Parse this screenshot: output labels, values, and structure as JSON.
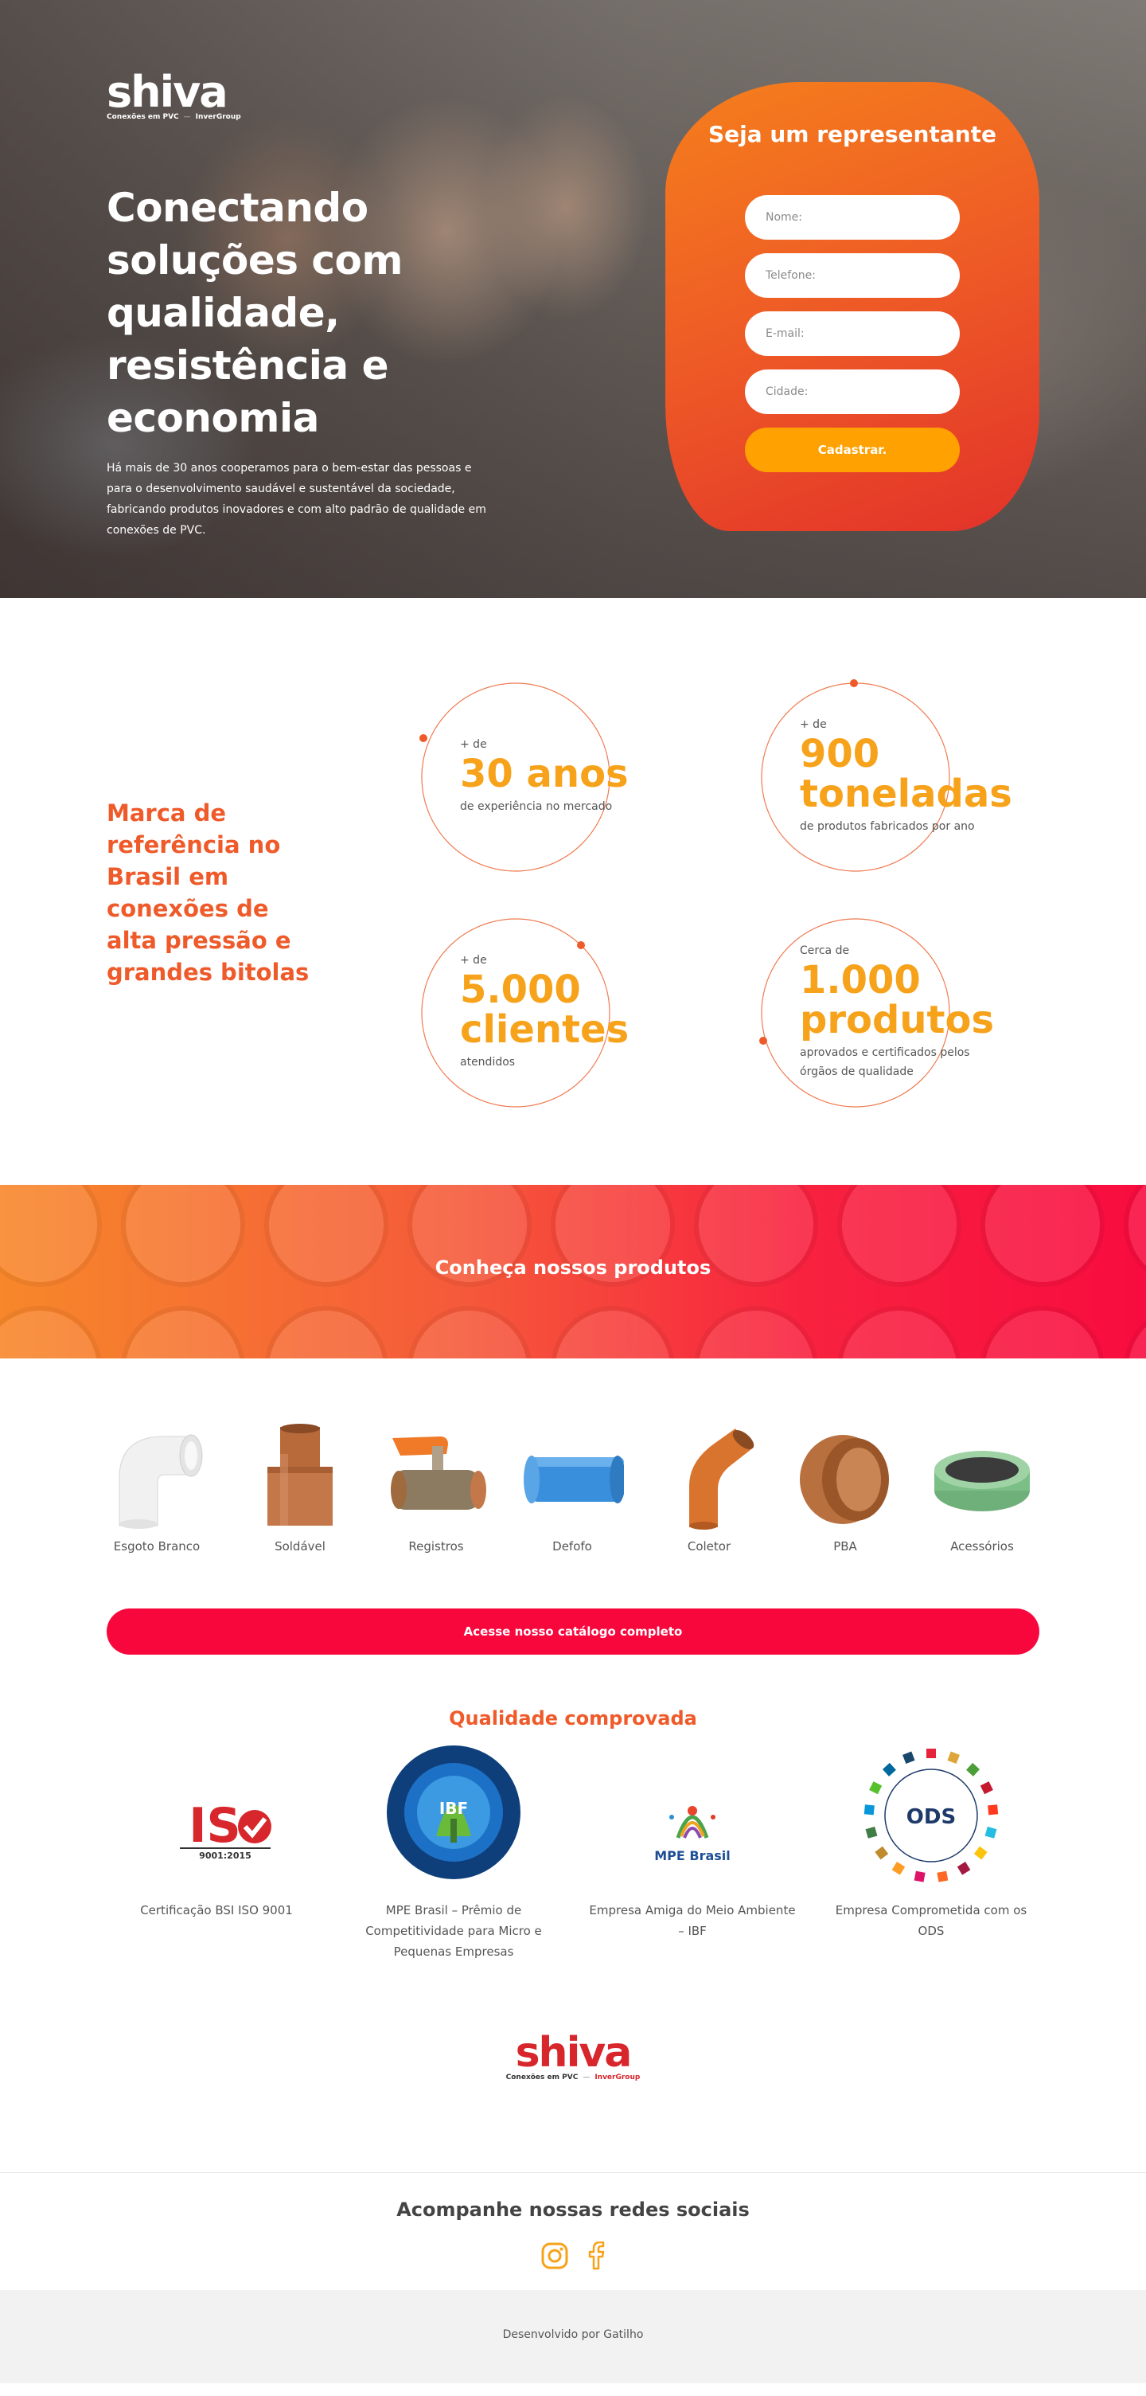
{
  "brand": {
    "name": "shiva",
    "tagline": "Conexões em PVC",
    "group": "InverGroup"
  },
  "hero": {
    "title": "Conectando soluções com qualidade, resistência e economia",
    "text": "Há mais de 30 anos cooperamos para o bem-estar das pessoas e para o desenvolvimento saudável e sustentável da sociedade, fabricando produtos inovadores e com alto padrão de qualidade em conexões de PVC."
  },
  "form": {
    "title": "Seja um representante",
    "name_placeholder": "Nome:",
    "phone_placeholder": "Telefone:",
    "email_placeholder": "E-mail:",
    "city_placeholder": "Cidade:",
    "submit_label": "Cadastrar."
  },
  "stats": {
    "heading": "Marca de referência no Brasil em conexões de alta pressão e grandes bitolas",
    "items": [
      {
        "prefix": "+ de",
        "value": "30 anos",
        "desc": "de experiência no mercado"
      },
      {
        "prefix": "+ de",
        "value": "900 toneladas",
        "desc": "de produtos fabricados por ano"
      },
      {
        "prefix": "+ de",
        "value": "5.000 clientes",
        "desc": "atendidos"
      },
      {
        "prefix": "Cerca de",
        "value": "1.000 produtos",
        "desc": "aprovados e certificados pelos órgãos de qualidade"
      }
    ]
  },
  "products": {
    "banner_title": "Conheça nossos produtos",
    "items": [
      {
        "label": "Esgoto Branco"
      },
      {
        "label": "Soldável"
      },
      {
        "label": "Registros"
      },
      {
        "label": "Defofo"
      },
      {
        "label": "Coletor"
      },
      {
        "label": "PBA"
      },
      {
        "label": "Acessórios"
      }
    ],
    "catalog_label": "Acesse nosso catálogo completo"
  },
  "quality": {
    "title": "Qualidade comprovada",
    "certs": [
      {
        "label": "Certificação BSI ISO 9001"
      },
      {
        "label": "MPE Brasil – Prêmio de Competitividade para Micro e Pequenas Empresas"
      },
      {
        "label": "Empresa Amiga do Meio Ambiente – IBF"
      },
      {
        "label": "Empresa Comprometida com os ODS"
      }
    ]
  },
  "social": {
    "title": "Acompanhe nossas redes sociais"
  },
  "footer": {
    "credit": "Desenvolvido por Gatilho"
  },
  "colors": {
    "orange": "#ef5a2a",
    "yellow": "#f7a21b",
    "red": "#f8073d",
    "brand_red": "#d7262c"
  }
}
